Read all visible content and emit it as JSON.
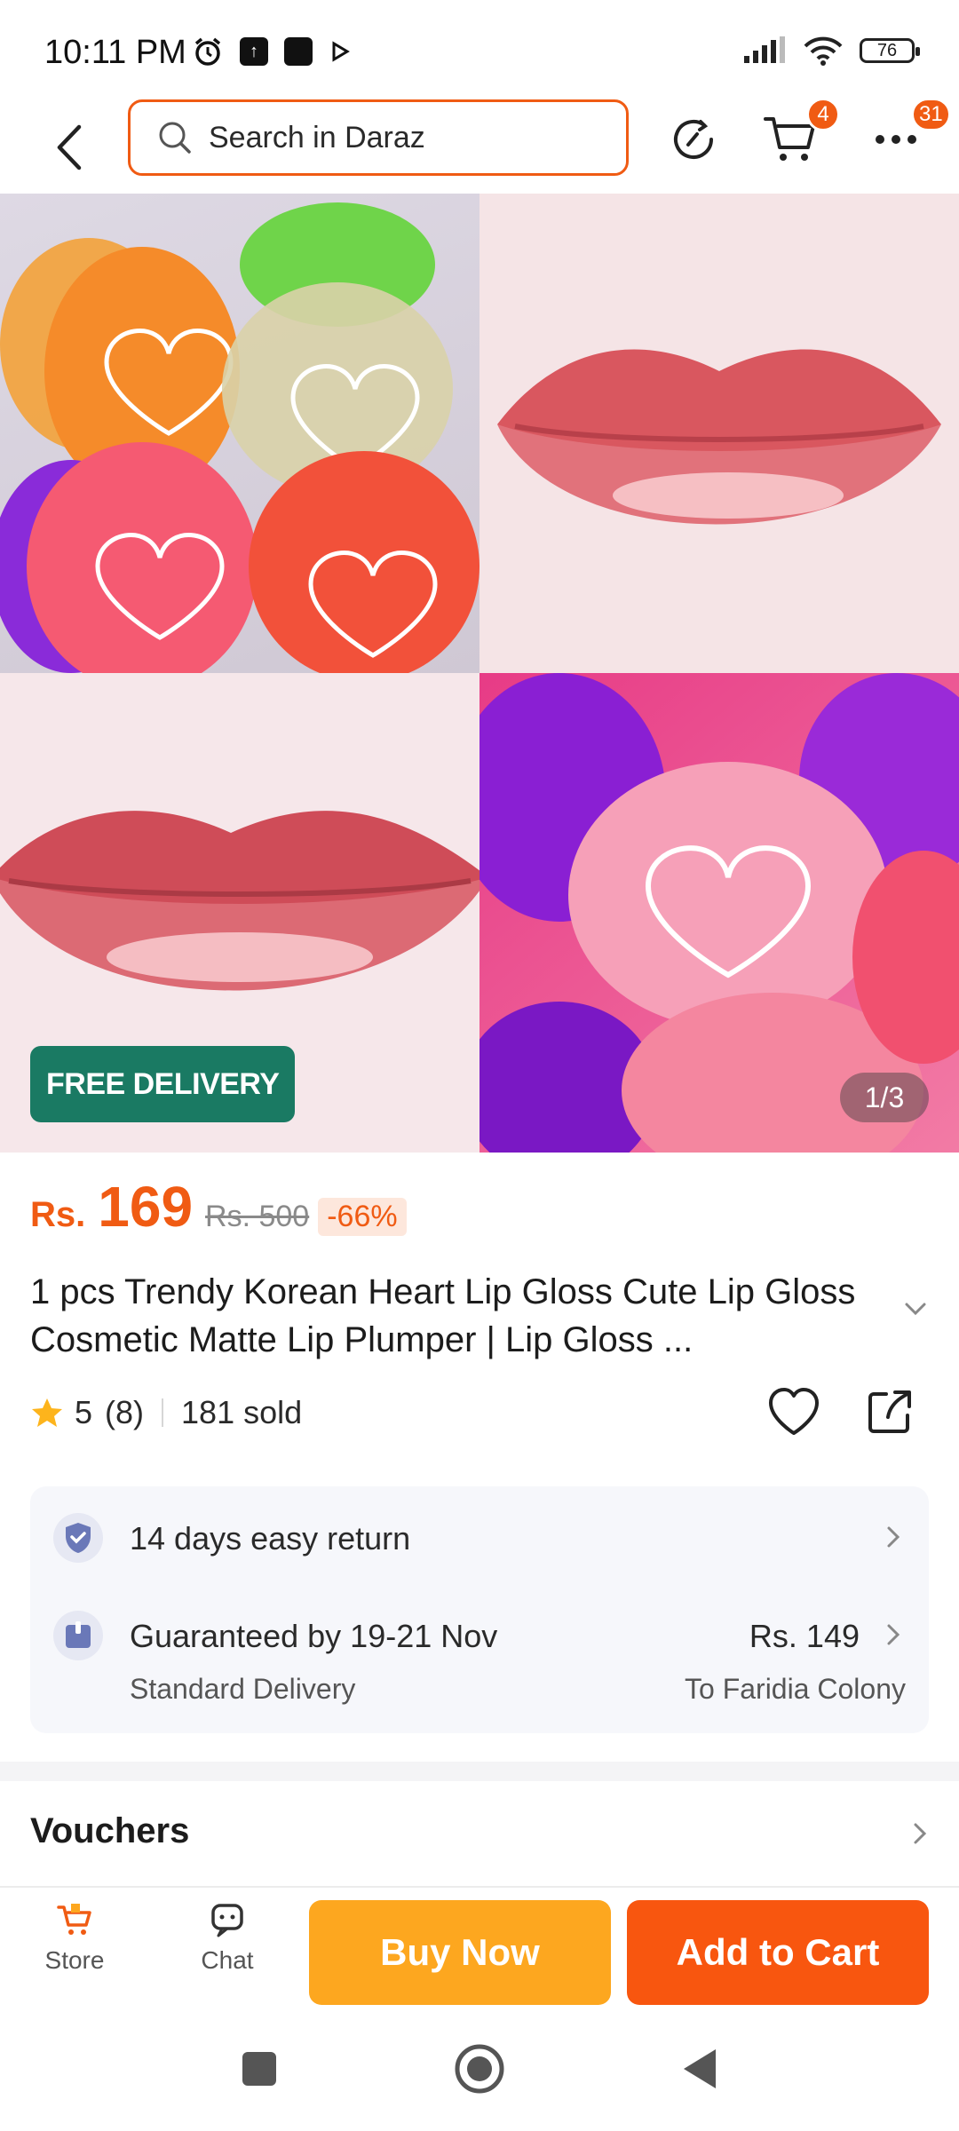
{
  "status_bar": {
    "time": "10:11 PM",
    "battery": "76"
  },
  "header": {
    "search_placeholder": "Search in Daraz",
    "cart_badge": "4",
    "more_badge": "31"
  },
  "gallery": {
    "free_delivery": "FREE DELIVERY",
    "counter": "1/3"
  },
  "product": {
    "currency": "Rs.",
    "price": "169",
    "old_price": "Rs. 500",
    "discount": "-66%",
    "title": "1 pcs Trendy Korean Heart Lip Gloss Cute Lip Gloss Cosmetic Matte Lip Plumper | Lip Gloss ...",
    "rating": "5",
    "reviews": "(8)",
    "sold": "181 sold"
  },
  "info": {
    "return_text": "14 days easy return",
    "delivery_text": "Guaranteed by 19-21 Nov",
    "delivery_type": "Standard Delivery",
    "delivery_price": "Rs. 149",
    "delivery_to": "To Faridia Colony"
  },
  "vouchers_label": "Vouchers",
  "bottom_bar": {
    "store": "Store",
    "chat": "Chat",
    "buy_now": "Buy Now",
    "add_to_cart": "Add to Cart"
  },
  "colors": {
    "accent": "#f05b13",
    "buy_now": "#fda71f",
    "add_to_cart": "#f8560f",
    "free_delivery": "#1a7a63"
  }
}
